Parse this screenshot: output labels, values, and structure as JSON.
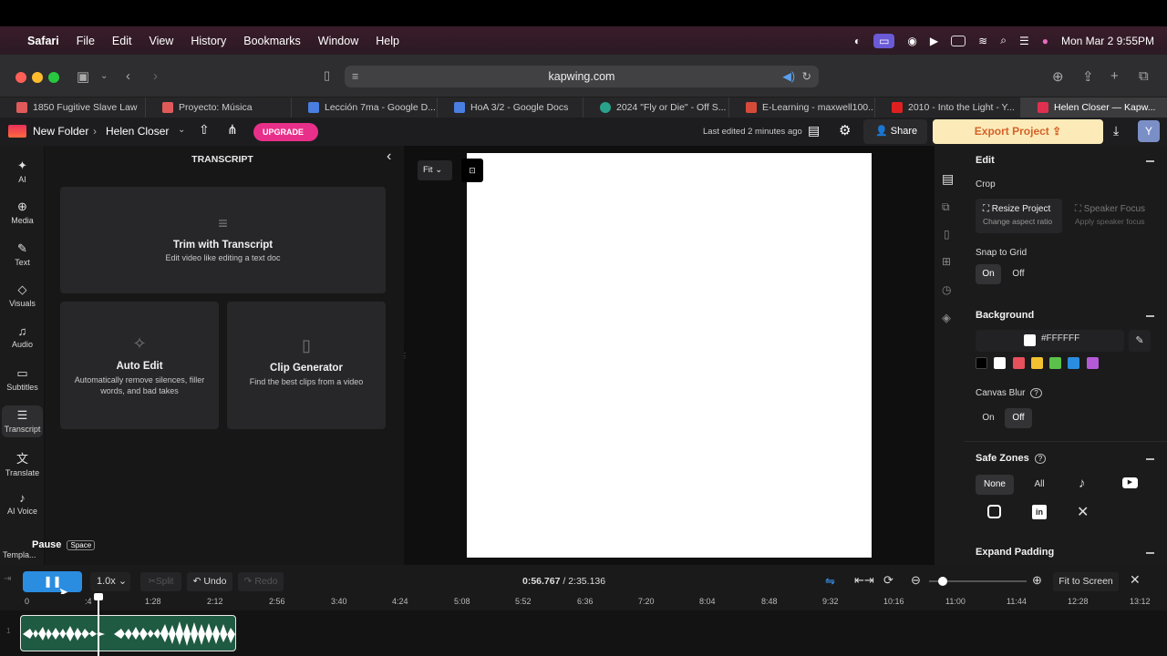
{
  "menubar": {
    "app": "Safari",
    "items": [
      "File",
      "Edit",
      "View",
      "History",
      "Bookmarks",
      "Window",
      "Help"
    ],
    "datetime": "Mon Mar 2  9:55PM"
  },
  "browser": {
    "url": "kapwing.com"
  },
  "tabs": [
    {
      "label": "1850 Fugitive Slave Law",
      "color": "#e05a5a"
    },
    {
      "label": "Proyecto: Música",
      "color": "#e05a5a"
    },
    {
      "label": "Lección 7ma - Google D...",
      "color": "#4a7ee0"
    },
    {
      "label": "HoA 3/2 - Google Docs",
      "color": "#4a7ee0"
    },
    {
      "label": "2024 \"Fly or Die\" - Off S...",
      "color": "#2aa18a"
    },
    {
      "label": "E-Learning - maxwell100...",
      "color": "#d64a3a"
    },
    {
      "label": "2010 - Into the Light - Y...",
      "color": "#e02020"
    },
    {
      "label": "Helen Closer — Kapw...",
      "color": "#e03050"
    }
  ],
  "header": {
    "folder": "New Folder",
    "project": "Helen Closer",
    "upgrade": "UPGRADE",
    "last_edited": "Last edited 2 minutes ago",
    "share": "Share",
    "export": "Export Project",
    "avatar": "Y"
  },
  "sidebar": [
    "AI",
    "Media",
    "Text",
    "Visuals",
    "Audio",
    "Subtitles",
    "Transcript",
    "Translate",
    "AI Voice",
    "Templa..."
  ],
  "panel": {
    "title": "TRANSCRIPT",
    "trim": {
      "title": "Trim with Transcript",
      "sub": "Edit video like editing a text doc"
    },
    "autoedit": {
      "title": "Auto Edit",
      "sub1": "Automatically remove silences, filler",
      "sub2": "words, and bad takes"
    },
    "clip": {
      "title": "Clip Generator",
      "sub": "Find the best clips from a video"
    },
    "pause": "Pause",
    "space": "Space"
  },
  "canvas": {
    "fit": "Fit"
  },
  "rightpanel": {
    "edit": "Edit",
    "crop": "Crop",
    "resize": "Resize Project",
    "resize_sub": "Change aspect ratio",
    "speaker": "Speaker Focus",
    "speaker_sub": "Apply speaker focus",
    "snap": "Snap to Grid",
    "on": "On",
    "off": "Off",
    "background": "Background",
    "hex": "#FFFFFF",
    "canvas_blur": "Canvas Blur",
    "safe_zones": "Safe Zones",
    "none": "None",
    "all": "All",
    "expand": "Expand Padding",
    "swatches": [
      "#000000",
      "#ffffff",
      "#e8505b",
      "#f2c230",
      "#5cc14a",
      "#2a8de0",
      "#b45ad6"
    ]
  },
  "playbar": {
    "speed": "1.0x",
    "split": "Split",
    "undo": "Undo",
    "redo": "Redo",
    "time": "0:56.767",
    "total": "/ 2:35.136",
    "fit": "Fit to Screen"
  },
  "ruler": [
    "0",
    "1:28",
    "2:12",
    "2:56",
    "3:40",
    "4:24",
    "5:08",
    "5:52",
    "6:36",
    "7:20",
    "8:04",
    "8:48",
    "9:32",
    "10:16",
    "11:00",
    "11:44",
    "12:28",
    "13:12"
  ]
}
